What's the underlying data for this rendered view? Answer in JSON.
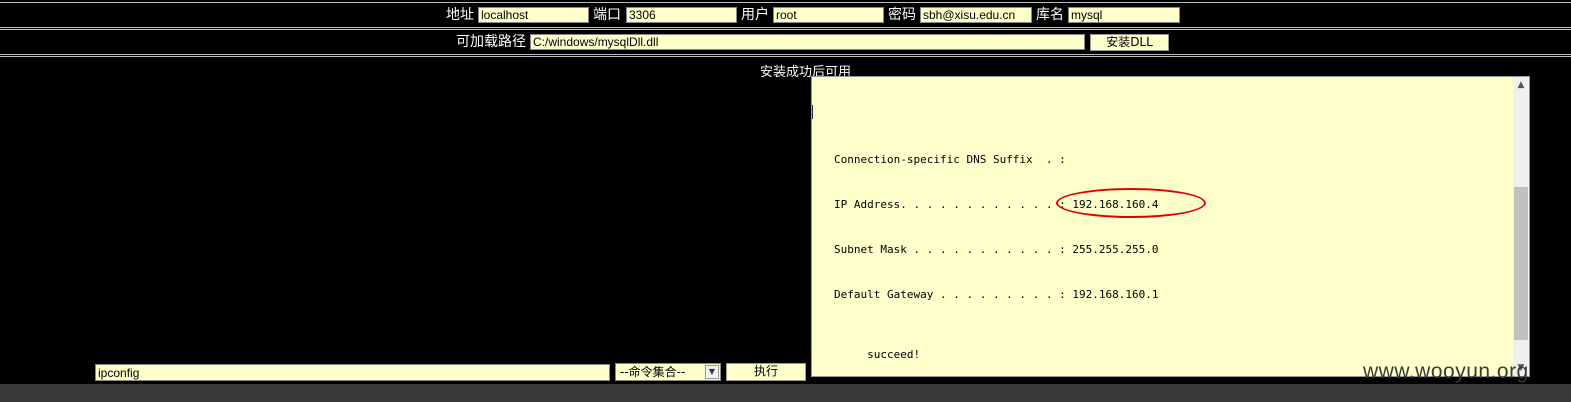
{
  "connection": {
    "host_label": "地址",
    "host_value": "localhost",
    "port_label": "端口",
    "port_value": "3306",
    "user_label": "用户",
    "user_value": "root",
    "password_label": "密码",
    "password_value": "sbh@xisu.edu.cn",
    "db_label": "库名",
    "db_value": "mysql"
  },
  "dll": {
    "path_label": "可加载路径",
    "path_value": "C:/windows/mysqlDll.dll",
    "install_button": "安装DLL"
  },
  "notice": "安装成功后可用",
  "output": {
    "lines": [
      "Connection-specific DNS Suffix  . :",
      "IP Address. . . . . . . . . . . . : 192.168.160.4",
      "Subnet Mask . . . . . . . . . . . : 255.255.255.0",
      "Default Gateway . . . . . . . . . : 192.168.160.1",
      "     succeed!"
    ],
    "highlight_color": "#e00000"
  },
  "command": {
    "input_value": "ipconfig",
    "select_value": "--命令集合--",
    "execute_button": "执行"
  },
  "watermark": "www.wooyun.org",
  "colors": {
    "field_bg": "#ffffcc",
    "page_bg": "#000000"
  }
}
